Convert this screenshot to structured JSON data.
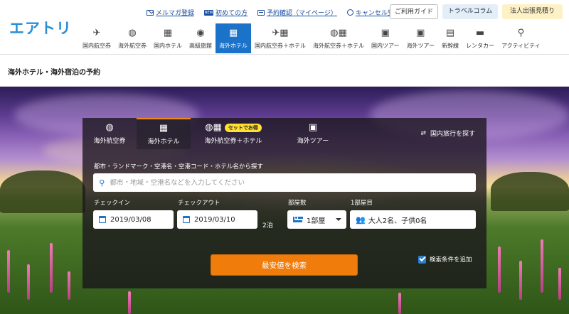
{
  "header": {
    "logo": "エアトリ",
    "top_links": [
      {
        "label": "メルマガ登録",
        "icon": "mail-icon"
      },
      {
        "label": "初めての方",
        "icon": "new-badge-icon"
      },
      {
        "label": "予約確認（マイページ）",
        "icon": "calendar-icon"
      },
      {
        "label": "キャンセル受付",
        "icon": "cancel-icon"
      }
    ],
    "buttons": {
      "guide": "ご利用ガイド",
      "column": "トラベルコラム",
      "corporate": "法人出張見積り"
    },
    "nav": [
      {
        "label": "国内航空券",
        "icon": "airplane-icon"
      },
      {
        "label": "海外航空券",
        "icon": "globe-plane-icon"
      },
      {
        "label": "国内ホテル",
        "icon": "building-icon"
      },
      {
        "label": "高級旅館",
        "icon": "ryokan-icon"
      },
      {
        "label": "海外ホテル",
        "icon": "building-icon",
        "active": true
      },
      {
        "label": "国内航空券＋ホテル",
        "icon": "plane-building-icon"
      },
      {
        "label": "海外航空券＋ホテル",
        "icon": "globe-building-icon"
      },
      {
        "label": "国内ツアー",
        "icon": "suitcase-icon"
      },
      {
        "label": "海外ツアー",
        "icon": "suitcase-icon"
      },
      {
        "label": "新幹線",
        "icon": "train-icon"
      },
      {
        "label": "レンタカー",
        "icon": "car-icon"
      },
      {
        "label": "アクティビティ",
        "icon": "runner-icon"
      }
    ]
  },
  "page_title": "海外ホテル・海外宿泊の予約",
  "search": {
    "tabs": [
      {
        "label": "海外航空券",
        "icon": "globe-plane-icon"
      },
      {
        "label": "海外ホテル",
        "icon": "building-icon",
        "active": true
      },
      {
        "label": "海外航空券＋ホテル",
        "icon": "globe-building-icon",
        "badge": "セットでお得"
      },
      {
        "label": "海外ツアー",
        "icon": "suitcase-icon"
      }
    ],
    "domestic_link": "国内旅行を探す",
    "destination_label": "都市・ランドマーク・空港名・空港コード・ホテル名から探す",
    "destination_placeholder": "都市・地域・空港名などを入力してください",
    "checkin_label": "チェックイン",
    "checkin_value": "2019/03/08",
    "checkout_label": "チェックアウト",
    "checkout_value": "2019/03/10",
    "nights": "2泊",
    "rooms_label": "部屋数",
    "rooms_value": "1部屋",
    "room1_label": "1部屋目",
    "guests_value": "大人2名、子供0名",
    "advanced_label": "検索条件を追加",
    "advanced_checked": true,
    "submit_label": "最安値を検索"
  },
  "colors": {
    "brand_blue": "#1b72c9",
    "search_orange": "#f07c0c",
    "badge_yellow": "#ffe033"
  }
}
